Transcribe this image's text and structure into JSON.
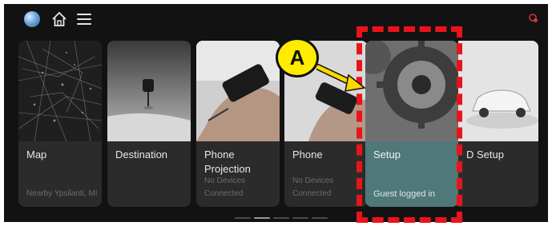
{
  "cards": [
    {
      "title": "Map",
      "subtitle": "Nearby Ypsilanti, MI"
    },
    {
      "title": "Destination",
      "subtitle": ""
    },
    {
      "title": "Phone Projection",
      "subtitle": "No Devices Connected"
    },
    {
      "title": "Phone",
      "subtitle": "No Devices Connected"
    },
    {
      "title": "Setup",
      "subtitle": "Guest logged in"
    },
    {
      "title": "D Setup",
      "subtitle": ""
    }
  ],
  "callout_label": "A",
  "page_indicator": {
    "count": 5,
    "active": 1
  },
  "colors": {
    "highlight": "#e8141b",
    "callout_fill": "#ffec00",
    "arrow": "#ffd800",
    "screen_bg": "#121212"
  },
  "icons": [
    "globe-icon",
    "home-icon",
    "menu-icon",
    "connectivity-icon"
  ]
}
